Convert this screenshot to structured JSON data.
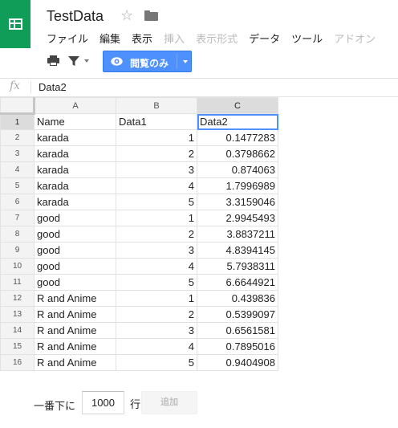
{
  "app": {
    "title": "TestData",
    "brand_color": "#0f9d58",
    "accent_color": "#4d90fe"
  },
  "menu": [
    {
      "label": "ファイル",
      "enabled": true
    },
    {
      "label": "編集",
      "enabled": true
    },
    {
      "label": "表示",
      "enabled": true
    },
    {
      "label": "挿入",
      "enabled": false
    },
    {
      "label": "表示形式",
      "enabled": false
    },
    {
      "label": "データ",
      "enabled": true
    },
    {
      "label": "ツール",
      "enabled": true
    },
    {
      "label": "アドオン",
      "enabled": false
    }
  ],
  "toolbar": {
    "print_icon": "print-icon",
    "filter_icon": "filter-icon",
    "view_only_label": "閲覧のみ",
    "view_only_icon": "eye-icon"
  },
  "formula_bar": {
    "icon_label": "fx",
    "value": "Data2"
  },
  "sheet": {
    "columns": [
      "A",
      "B",
      "C"
    ],
    "selected_column": "C",
    "selected_row": "1",
    "rows": [
      {
        "num": "1",
        "cells": [
          "Name",
          "Data1",
          "Data2"
        ]
      },
      {
        "num": "2",
        "cells": [
          "karada",
          "1",
          "0.1477283"
        ]
      },
      {
        "num": "3",
        "cells": [
          "karada",
          "2",
          "0.3798662"
        ]
      },
      {
        "num": "4",
        "cells": [
          "karada",
          "3",
          "0.874063"
        ]
      },
      {
        "num": "5",
        "cells": [
          "karada",
          "4",
          "1.7996989"
        ]
      },
      {
        "num": "6",
        "cells": [
          "karada",
          "5",
          "3.3159046"
        ]
      },
      {
        "num": "7",
        "cells": [
          "good",
          "1",
          "2.9945493"
        ]
      },
      {
        "num": "8",
        "cells": [
          "good",
          "2",
          "3.8837211"
        ]
      },
      {
        "num": "9",
        "cells": [
          "good",
          "3",
          "4.8394145"
        ]
      },
      {
        "num": "10",
        "cells": [
          "good",
          "4",
          "5.7938311"
        ]
      },
      {
        "num": "11",
        "cells": [
          "good",
          "5",
          "6.6644921"
        ]
      },
      {
        "num": "12",
        "cells": [
          "R and Anime",
          "1",
          "0.439836"
        ]
      },
      {
        "num": "13",
        "cells": [
          "R and Anime",
          "2",
          "0.5399097"
        ]
      },
      {
        "num": "14",
        "cells": [
          "R and Anime",
          "3",
          "0.6561581"
        ]
      },
      {
        "num": "15",
        "cells": [
          "R and Anime",
          "4",
          "0.7895016"
        ]
      },
      {
        "num": "16",
        "cells": [
          "R and Anime",
          "5",
          "0.9404908"
        ]
      }
    ]
  },
  "add_rows": {
    "prefix": "一番下に",
    "count": "1000",
    "suffix": "行",
    "button_label": "追加"
  }
}
